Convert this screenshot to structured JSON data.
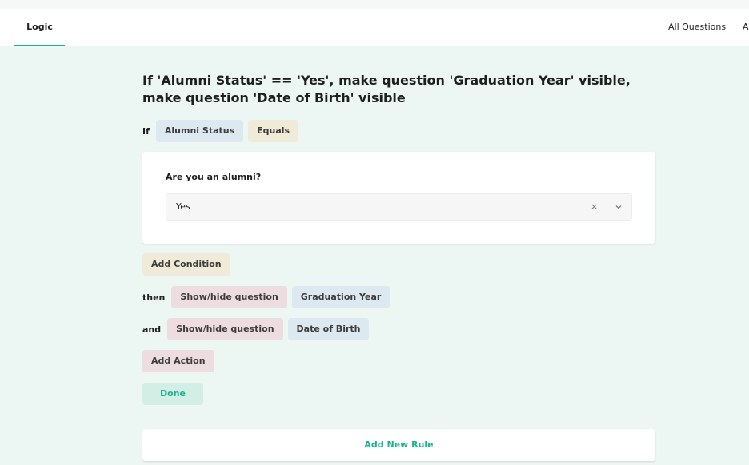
{
  "tabs": {
    "active": "Logic",
    "all_questions": "All Questions",
    "cut_off": "A"
  },
  "rule": {
    "title": "If 'Alumni Status' == 'Yes', make question 'Graduation Year' visible, make question 'Date of Birth' visible",
    "condition": {
      "keyword": "If",
      "question": "Alumni Status",
      "operator": "Equals"
    },
    "question_card": {
      "title": "Are you an alumni?",
      "selected_value": "Yes",
      "clear_glyph": "×"
    },
    "add_condition_label": "Add Condition",
    "actions": [
      {
        "keyword": "then",
        "type": "Show/hide question",
        "target": "Graduation Year"
      },
      {
        "keyword": "and",
        "type": "Show/hide question",
        "target": "Date of Birth"
      }
    ],
    "add_action_label": "Add Action",
    "done_label": "Done"
  },
  "add_new_rule_label": "Add New Rule",
  "colors": {
    "accent": "#19b394",
    "background": "#ecf6f2",
    "question_pill": "#dde9f0",
    "operator_pill": "#efebd8",
    "action_pill": "#eddce0"
  },
  "icons": {
    "clear": "clear-icon",
    "dropdown": "chevron-down-icon"
  }
}
